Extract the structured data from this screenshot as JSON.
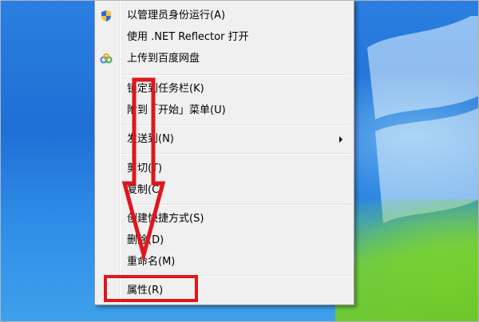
{
  "menu": {
    "items": [
      {
        "label": "以管理员身份运行(A)",
        "icon": "uac-shield-icon"
      },
      {
        "label": "使用 .NET Reflector 打开",
        "icon": ""
      },
      {
        "label": "上传到百度网盘",
        "icon": "baidu-netdisk-icon"
      },
      {
        "label": "锁定到任务栏(K)",
        "icon": ""
      },
      {
        "label": "附到「开始」菜单(U)",
        "icon": ""
      },
      {
        "label": "发送到(N)",
        "icon": "",
        "submenu": true
      },
      {
        "label": "剪切(T)",
        "icon": ""
      },
      {
        "label": "复制(C)",
        "icon": ""
      },
      {
        "label": "创建快捷方式(S)",
        "icon": ""
      },
      {
        "label": "删除(D)",
        "icon": ""
      },
      {
        "label": "重命名(M)",
        "icon": ""
      },
      {
        "label": "属性(R)",
        "icon": ""
      }
    ]
  },
  "annotation": {
    "arrow_color": "#e0161c",
    "highlight_target": "属性(R)"
  },
  "colors": {
    "menu_bg": "#f0f0f0",
    "desktop": "#1f6fd6",
    "annotation": "#e0161c"
  }
}
